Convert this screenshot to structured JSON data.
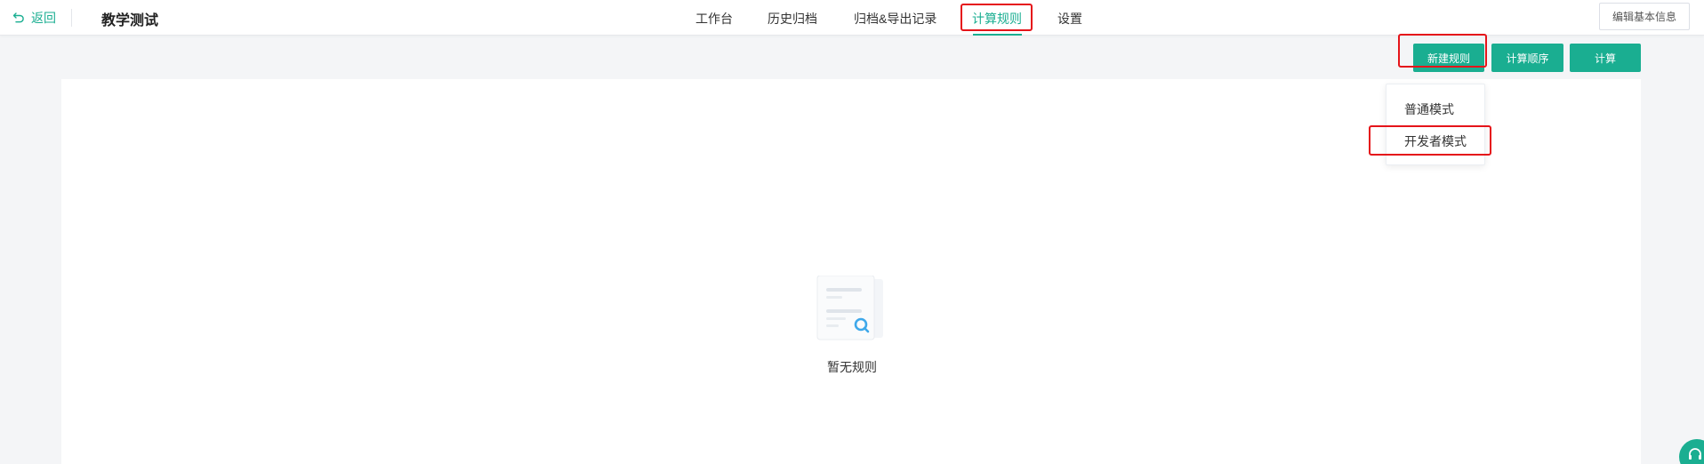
{
  "header": {
    "back_label": "返回",
    "title": "教学测试",
    "tabs": [
      {
        "label": "工作台"
      },
      {
        "label": "历史归档"
      },
      {
        "label": "归档&导出记录"
      },
      {
        "label": "计算规则",
        "active": true
      },
      {
        "label": "设置"
      }
    ],
    "edit_info_label": "编辑基本信息"
  },
  "toolbar": {
    "new_rule_label": "新建规则",
    "calc_order_label": "计算顺序",
    "calc_label": "计算"
  },
  "dropdown": {
    "items": [
      {
        "label": "普通模式"
      },
      {
        "label": "开发者模式"
      }
    ]
  },
  "empty_state": {
    "text": "暂无规则",
    "icon": "empty-document-search-icon"
  },
  "colors": {
    "accent": "#1aae91",
    "highlight": "#e5141a"
  }
}
